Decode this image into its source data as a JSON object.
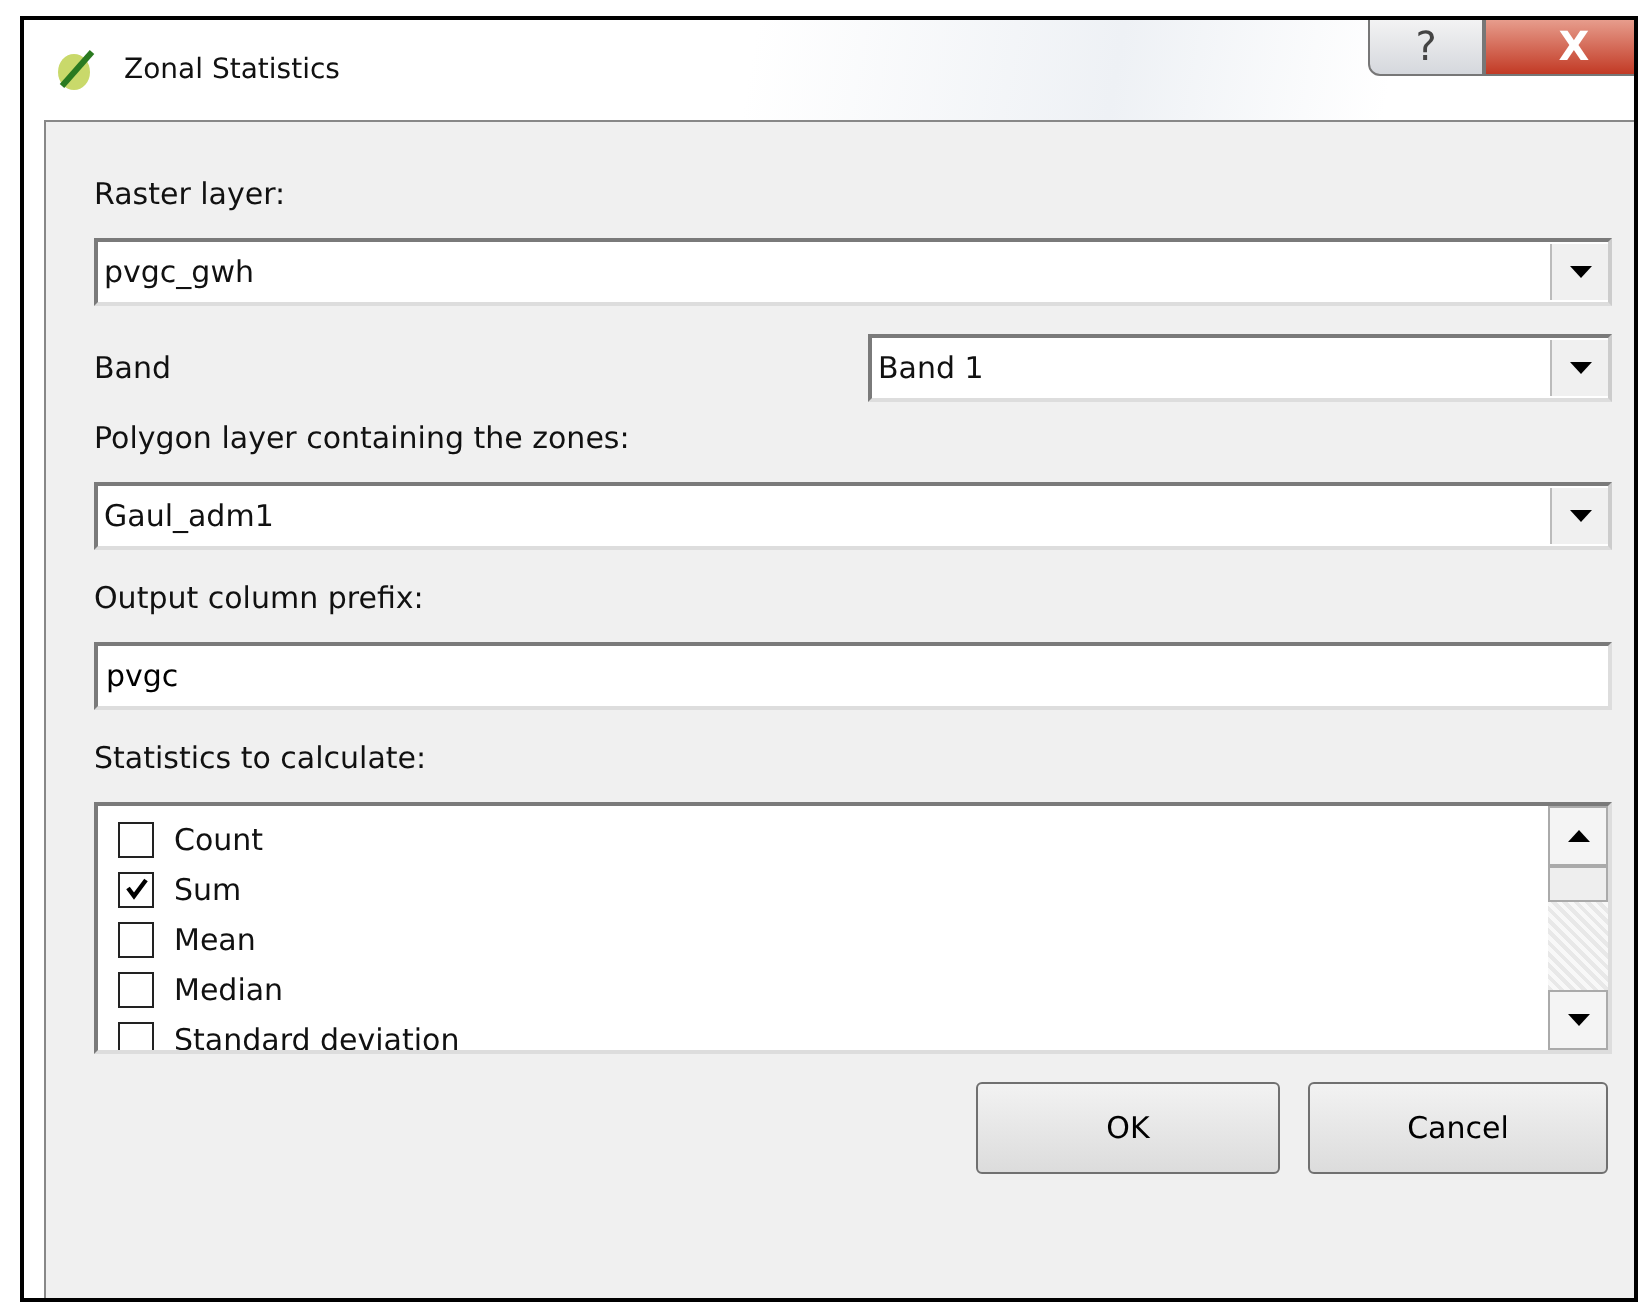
{
  "window": {
    "title": "Zonal Statistics",
    "help_button": "?",
    "close_button": "X"
  },
  "raster_layer": {
    "label": "Raster layer:",
    "value": "pvgc_gwh"
  },
  "band": {
    "label": "Band",
    "value": "Band 1"
  },
  "polygon_layer": {
    "label": "Polygon layer containing the zones:",
    "value": "Gaul_adm1"
  },
  "prefix": {
    "label": "Output column prefix:",
    "value": "pvgc"
  },
  "statistics": {
    "label": "Statistics to calculate:",
    "items": [
      {
        "label": "Count",
        "checked": false
      },
      {
        "label": "Sum",
        "checked": true
      },
      {
        "label": "Mean",
        "checked": false
      },
      {
        "label": "Median",
        "checked": false
      },
      {
        "label": "Standard deviation",
        "checked": false
      }
    ]
  },
  "buttons": [
    "OK",
    "Cancel"
  ]
}
